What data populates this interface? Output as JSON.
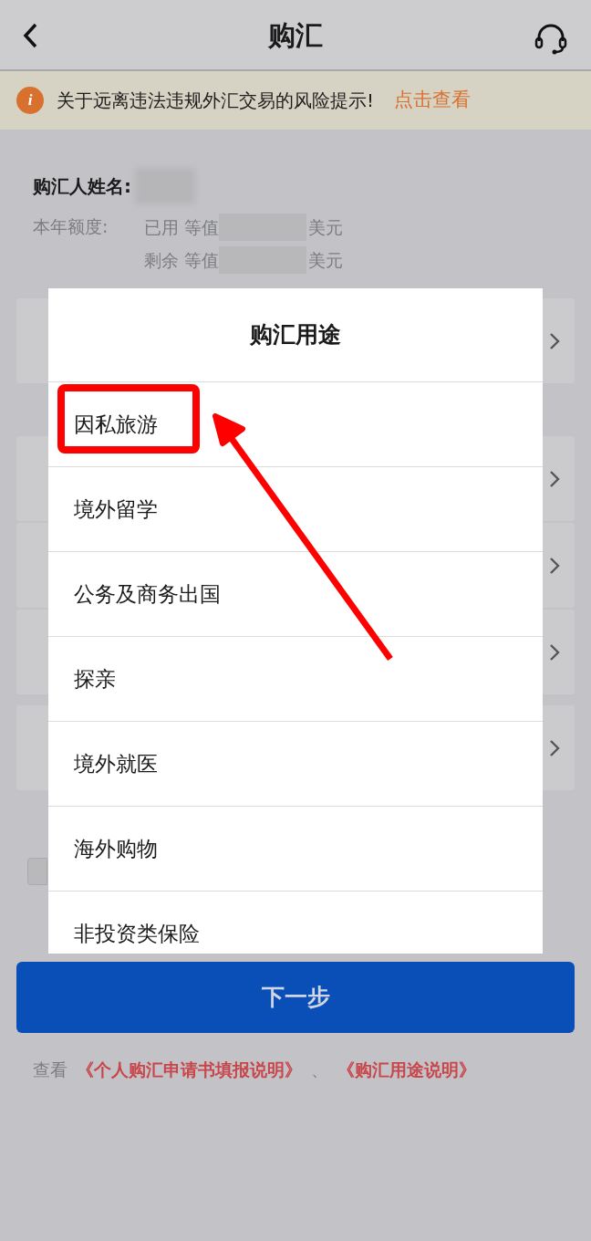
{
  "nav": {
    "title": "购汇"
  },
  "notice": {
    "icon": "i",
    "text": "关于远离违法违规外汇交易的风险提示!",
    "link": "点击查看"
  },
  "buyer": {
    "label": "购汇人姓名:"
  },
  "quota": {
    "label": "本年额度:",
    "lines": [
      {
        "prefix": "已用 等值",
        "unit": "美元"
      },
      {
        "prefix": "剩余 等值",
        "unit": "美元"
      }
    ]
  },
  "picker": {
    "title": "购汇用途",
    "options": [
      {
        "label": "因私旅游",
        "highlighted": true
      },
      {
        "label": "境外留学",
        "highlighted": false
      },
      {
        "label": "公务及商务出国",
        "highlighted": false
      },
      {
        "label": "探亲",
        "highlighted": false
      },
      {
        "label": "境外就医",
        "highlighted": false
      },
      {
        "label": "海外购物",
        "highlighted": false
      },
      {
        "label": "非投资类保险",
        "highlighted": false
      }
    ]
  },
  "agreement": {
    "checked": false
  },
  "next_button": "下一步",
  "footer": {
    "prefix": "查看",
    "links": [
      "《个人购汇申请书填报说明》",
      "《购汇用途说明》"
    ],
    "separator": "、"
  }
}
